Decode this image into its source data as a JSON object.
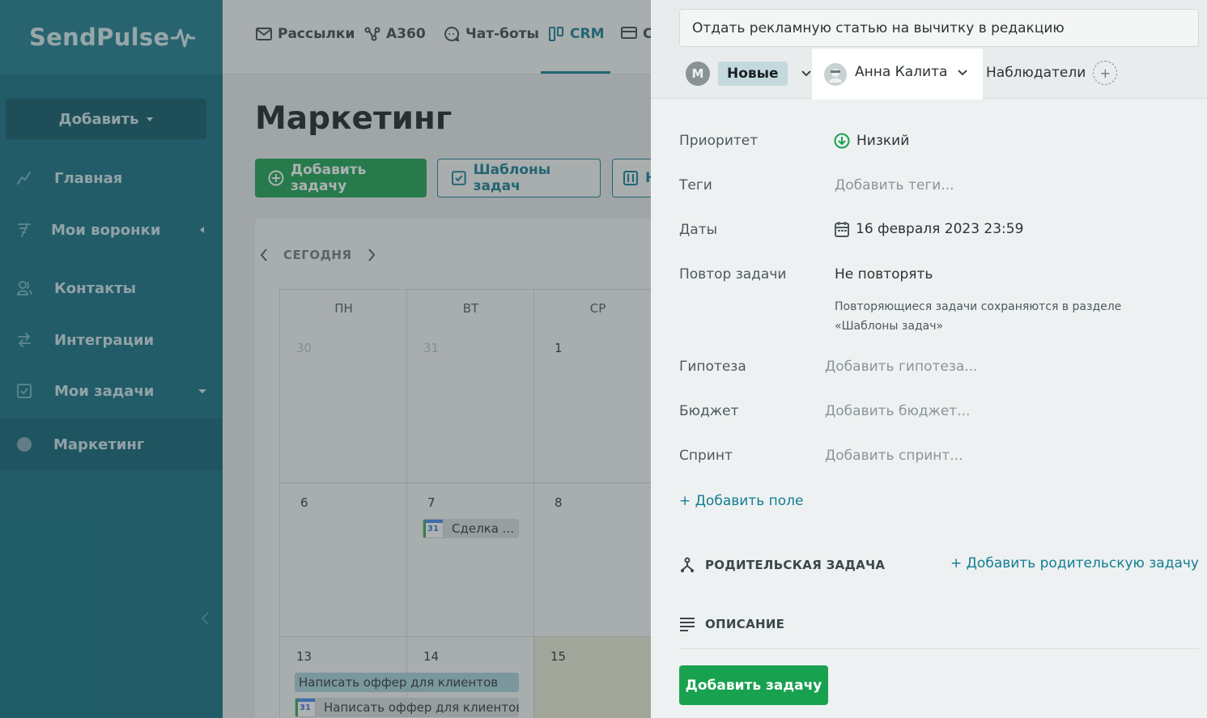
{
  "sidebar": {
    "logo": "SendPulse",
    "add_button": "Добавить",
    "items": [
      {
        "label": "Главная"
      },
      {
        "label": "Мои воронки"
      },
      {
        "label": "Контакты"
      },
      {
        "label": "Интеграции"
      },
      {
        "label": "Мои задачи"
      },
      {
        "label": "Маркетинг"
      }
    ]
  },
  "topnav": {
    "items": [
      "Рассылки",
      "A360",
      "Чат-боты",
      "CRM",
      "C"
    ]
  },
  "main": {
    "title": "Маркетинг",
    "add_task": "Добавить задачу",
    "templates": "Шаблоны задач",
    "third_button": "Н",
    "calendar": {
      "today": "СЕГОДНЯ",
      "weekdays": [
        "ПН",
        "ВТ",
        "СР"
      ],
      "rows": [
        [
          "30",
          "31",
          "1"
        ],
        [
          "6",
          "7",
          "8"
        ],
        [
          "13",
          "14",
          "15"
        ]
      ],
      "events": {
        "deal": "Сделка ...",
        "offer1": "Написать оффер для клиентов",
        "offer2": "Написать оффер для клиентов",
        "gcal_day": "31"
      }
    }
  },
  "panel": {
    "task_title": "Отдать рекламную статью на вычитку в редакцию",
    "creator_initial": "M",
    "status": "Новые",
    "assignee": "Анна Калита",
    "watchers": "Наблюдатели",
    "fields": {
      "priority_label": "Приоритет",
      "priority_value": "Низкий",
      "tags_label": "Теги",
      "tags_placeholder": "Добавить теги...",
      "dates_label": "Даты",
      "dates_value": "16 февраля 2023 23:59",
      "repeat_label": "Повтор задачи",
      "repeat_value": "Не повторять",
      "repeat_note": "Повторяющиеся задачи сохраняются в разделе «Шаблоны задач»",
      "hypothesis_label": "Гипотеза",
      "hypothesis_placeholder": "Добавить гипотеза...",
      "budget_label": "Бюджет",
      "budget_placeholder": "Добавить бюджет...",
      "sprint_label": "Спринт",
      "sprint_placeholder": "Добавить спринт..."
    },
    "add_field": "+ Добавить поле",
    "parent_task_title": "РОДИТЕЛЬСКАЯ ЗАДАЧА",
    "add_parent": "+ Добавить родительскую задачу",
    "description_title": "ОПИСАНИЕ",
    "submit": "Добавить задачу"
  },
  "colors": {
    "sidebar": "#0e6d80",
    "accent": "#127d93",
    "primary_button": "#18a14f"
  }
}
